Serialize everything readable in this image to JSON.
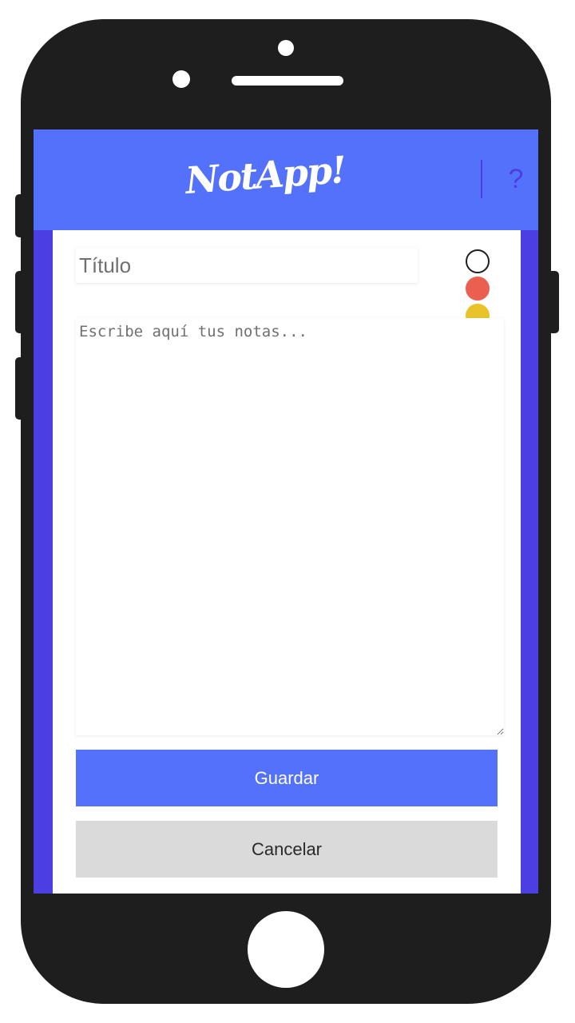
{
  "app": {
    "logo_text": "NotApp!",
    "help_label": "?"
  },
  "editor": {
    "title_placeholder": "Título",
    "notes_placeholder": "Escribe aquí tus notas...",
    "colors": [
      {
        "name": "white",
        "fill": "#ffffff",
        "border": "#1e1e1e"
      },
      {
        "name": "red",
        "fill": "#eb5f50",
        "border": "#eb5f50"
      },
      {
        "name": "yellow",
        "fill": "#e8c42a",
        "border": "#e8c42a"
      },
      {
        "name": "green",
        "fill": "#2ee07f",
        "border": "#2ee07f"
      }
    ]
  },
  "actions": {
    "save_label": "Guardar",
    "cancel_label": "Cancelar"
  },
  "theme": {
    "header_color": "#5371fb",
    "frame_color": "#4b3fe3",
    "cancel_color": "#dadada"
  }
}
